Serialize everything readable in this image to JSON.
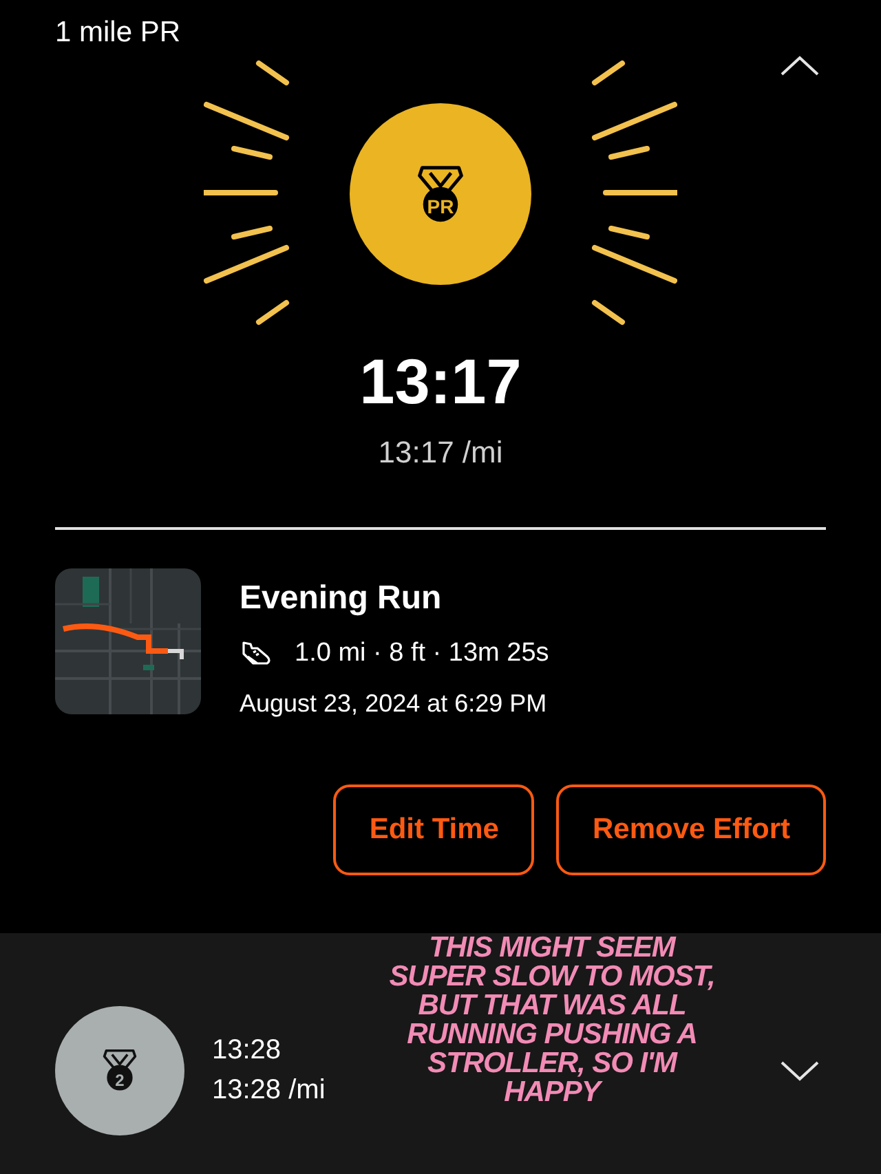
{
  "header": {
    "title": "1 mile PR",
    "expanded": true
  },
  "badge": {
    "label": "PR"
  },
  "time": "13:17",
  "pace": "13:17 /mi",
  "activity": {
    "name": "Evening Run",
    "stats": "1.0 mi · 8 ft · 13m 25s",
    "date": "August 23, 2024 at 6:29 PM"
  },
  "buttons": [
    "Edit Time",
    "Remove Effort"
  ],
  "efforts": [
    {
      "rank": "2",
      "time": "13:28",
      "pace": "13:28 /mi",
      "expanded": false
    }
  ],
  "annotation": "THIS MIGHT SEEM SUPER SLOW TO MOST, BUT THAT WAS ALL RUNNING PUSHING A STROLLER, SO I'M HAPPY"
}
